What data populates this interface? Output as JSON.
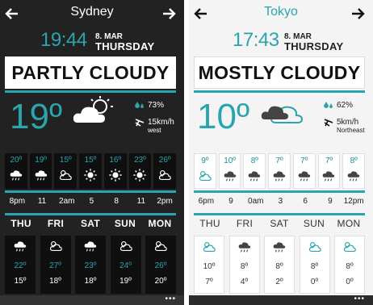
{
  "phones": [
    {
      "city": "Sydney",
      "time": "19:44",
      "date_day": "8. MAR",
      "date_weekday": "THURSDAY",
      "condition": "PARTLY CLOUDY",
      "temperature": "19º",
      "humidity": "73%",
      "wind": "15km/h",
      "wind_dir": "west",
      "hourly": [
        {
          "temp": "20º",
          "icon": "cloud-rain-icon"
        },
        {
          "temp": "19º",
          "icon": "cloud-rain-icon"
        },
        {
          "temp": "15º",
          "icon": "cloud-sun-icon"
        },
        {
          "temp": "15º",
          "icon": "sun-icon"
        },
        {
          "temp": "16º",
          "icon": "sun-icon"
        },
        {
          "temp": "23º",
          "icon": "sun-icon"
        },
        {
          "temp": "26º",
          "icon": "cloud-sun-icon"
        }
      ],
      "hour_labels": [
        "8pm",
        "11",
        "2am",
        "5",
        "8",
        "11",
        "2pm"
      ],
      "days": [
        {
          "name": "THU",
          "high": "22º",
          "low": "15º",
          "icon": "cloud-rain-icon"
        },
        {
          "name": "FRI",
          "high": "27º",
          "low": "18º",
          "icon": "cloud-sun-icon"
        },
        {
          "name": "SAT",
          "high": "23º",
          "low": "18º",
          "icon": "cloud-rain-icon"
        },
        {
          "name": "SUN",
          "high": "24º",
          "low": "19º",
          "icon": "cloud-sun-icon"
        },
        {
          "name": "MON",
          "high": "26º",
          "low": "20º",
          "icon": "cloud-sun-icon"
        }
      ],
      "more_label": "•••"
    },
    {
      "city": "Tokyo",
      "time": "17:43",
      "date_day": "8. MAR",
      "date_weekday": "THURSDAY",
      "condition": "MOSTLY CLOUDY",
      "temperature": "10º",
      "humidity": "62%",
      "wind": "5km/h",
      "wind_dir": "Northeast",
      "hourly": [
        {
          "temp": "9º",
          "icon": "cloud-sun-icon"
        },
        {
          "temp": "10º",
          "icon": "cloud-rain-icon"
        },
        {
          "temp": "8º",
          "icon": "cloud-rain-icon"
        },
        {
          "temp": "7º",
          "icon": "cloud-rain-icon"
        },
        {
          "temp": "7º",
          "icon": "cloud-rain-icon"
        },
        {
          "temp": "7º",
          "icon": "cloud-rain-icon"
        },
        {
          "temp": "8º",
          "icon": "cloud-rain-icon"
        }
      ],
      "hour_labels": [
        "6pm",
        "9",
        "0am",
        "3",
        "6",
        "9",
        "12pm"
      ],
      "days": [
        {
          "name": "THU",
          "high": "10º",
          "low": "7º",
          "icon": "cloud-sun-icon"
        },
        {
          "name": "FRI",
          "high": "8º",
          "low": "4º",
          "icon": "cloud-rain-icon"
        },
        {
          "name": "SAT",
          "high": "8º",
          "low": "2º",
          "icon": "cloud-rain-icon"
        },
        {
          "name": "SUN",
          "high": "8º",
          "low": "0º",
          "icon": "cloud-sun-icon"
        },
        {
          "name": "MON",
          "high": "8º",
          "low": "0º",
          "icon": "cloud-sun-icon"
        }
      ],
      "more_label": "•••"
    }
  ],
  "colors": {
    "accent": "#2aa5ad",
    "dark_bg": "#222222",
    "light_bg": "#f4f4f4"
  }
}
